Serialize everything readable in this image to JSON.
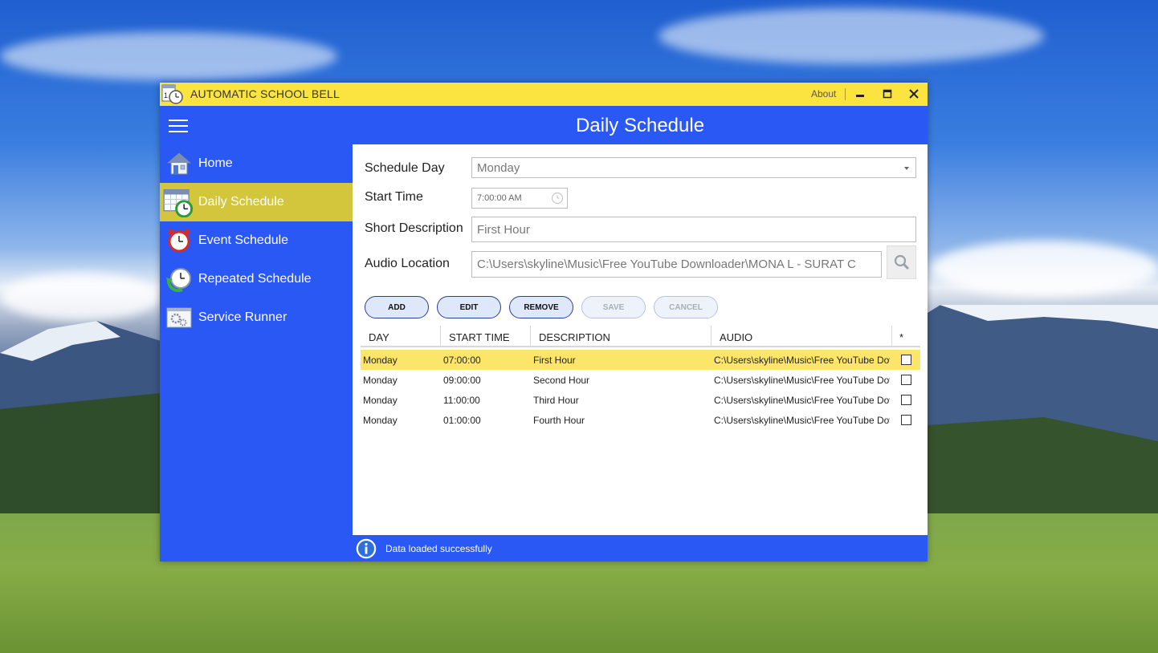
{
  "window": {
    "title": "AUTOMATIC SCHOOL BELL",
    "about_label": "About",
    "minimize_glyph": "▁",
    "maximize_glyph": "□",
    "close_glyph": "✕"
  },
  "header": {
    "page_title": "Daily Schedule"
  },
  "sidebar": {
    "items": [
      {
        "label": "Home",
        "icon": "home-icon",
        "active": false
      },
      {
        "label": "Daily Schedule",
        "icon": "calendar-clock-icon",
        "active": true
      },
      {
        "label": "Event Schedule",
        "icon": "alarm-clock-icon",
        "active": false
      },
      {
        "label": "Repeated Schedule",
        "icon": "repeat-clock-icon",
        "active": false
      },
      {
        "label": "Service Runner",
        "icon": "service-gears-icon",
        "active": false
      }
    ]
  },
  "form": {
    "schedule_day_label": "Schedule Day",
    "schedule_day_value": "Monday",
    "start_time_label": "Start Time",
    "start_time_value": "7:00:00 AM",
    "short_description_label": "Short Description",
    "short_description_value": "First Hour",
    "audio_location_label": "Audio Location",
    "audio_location_value": "C:\\Users\\skyline\\Music\\Free YouTube Downloader\\MONA L - SURAT C"
  },
  "actions": {
    "add": "ADD",
    "edit": "EDIT",
    "remove": "REMOVE",
    "save": "SAVE",
    "cancel": "CANCEL"
  },
  "grid": {
    "columns": [
      "DAY",
      "START TIME",
      "DESCRIPTION",
      "AUDIO",
      "*"
    ],
    "rows": [
      {
        "day": "Monday",
        "start": "07:00:00",
        "desc": "First Hour",
        "audio": "C:\\Users\\skyline\\Music\\Free YouTube Dov",
        "checked": false,
        "selected": true
      },
      {
        "day": "Monday",
        "start": "09:00:00",
        "desc": "Second Hour",
        "audio": "C:\\Users\\skyline\\Music\\Free YouTube Dov",
        "checked": false,
        "selected": false
      },
      {
        "day": "Monday",
        "start": "11:00:00",
        "desc": "Third Hour",
        "audio": "C:\\Users\\skyline\\Music\\Free YouTube Dov",
        "checked": false,
        "selected": false
      },
      {
        "day": "Monday",
        "start": "01:00:00",
        "desc": "Fourth Hour",
        "audio": "C:\\Users\\skyline\\Music\\Free YouTube Dov",
        "checked": false,
        "selected": false
      }
    ]
  },
  "status": {
    "message": "Data loaded successfully",
    "icon": "info-icon"
  },
  "colors": {
    "titlebar": "#fbe340",
    "chrome_blue": "#2a58f5",
    "active_nav": "#d3c53c",
    "selected_row": "#fbe66a"
  }
}
